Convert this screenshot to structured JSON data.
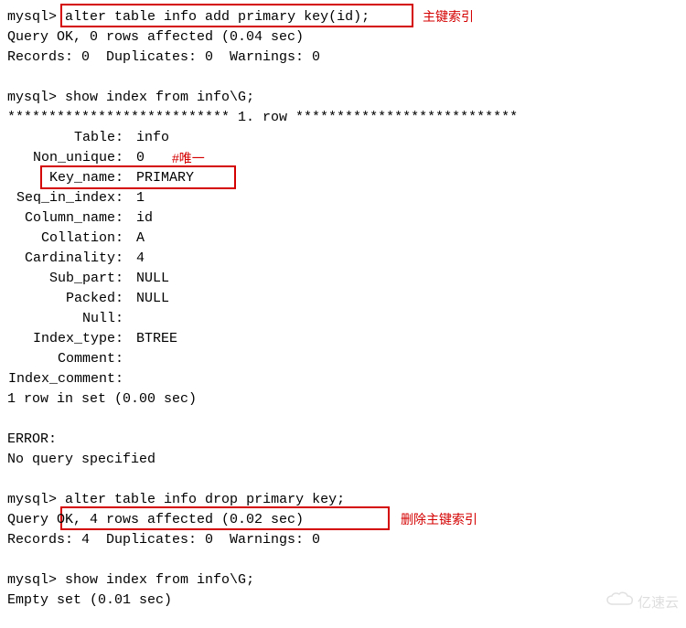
{
  "prompt": "mysql>",
  "commands": {
    "alter_add": "alter table info add primary key(id);",
    "show_index1": "show index from info\\G;",
    "alter_drop": "alter table info drop primary key;",
    "show_index2": "show index from info\\G;"
  },
  "results": {
    "add_ok": "Query OK, 0 rows affected (0.04 sec)",
    "add_rec": "Records: 0  Duplicates: 0  Warnings: 0",
    "row_divider": "*************************** 1. row ***************************",
    "row_in_set": "1 row in set (0.00 sec)",
    "error_hdr": "ERROR:",
    "error_msg": "No query specified",
    "drop_ok": "Query OK, 4 rows affected (0.02 sec)",
    "drop_rec": "Records: 4  Duplicates: 0  Warnings: 0",
    "empty_set": "Empty set (0.01 sec)"
  },
  "index_rows": [
    {
      "label": "Table",
      "value": "info"
    },
    {
      "label": "Non_unique",
      "value": "0"
    },
    {
      "label": "Key_name",
      "value": "PRIMARY"
    },
    {
      "label": "Seq_in_index",
      "value": "1"
    },
    {
      "label": "Column_name",
      "value": "id"
    },
    {
      "label": "Collation",
      "value": "A"
    },
    {
      "label": "Cardinality",
      "value": "4"
    },
    {
      "label": "Sub_part",
      "value": "NULL"
    },
    {
      "label": "Packed",
      "value": "NULL"
    },
    {
      "label": "Null",
      "value": ""
    },
    {
      "label": "Index_type",
      "value": "BTREE"
    },
    {
      "label": "Comment",
      "value": ""
    },
    {
      "label": "Index_comment",
      "value": ""
    }
  ],
  "annotations": {
    "primary_index": "主键索引",
    "unique_note": "#唯一",
    "drop_primary": "删除主键索引"
  },
  "watermark": "亿速云"
}
